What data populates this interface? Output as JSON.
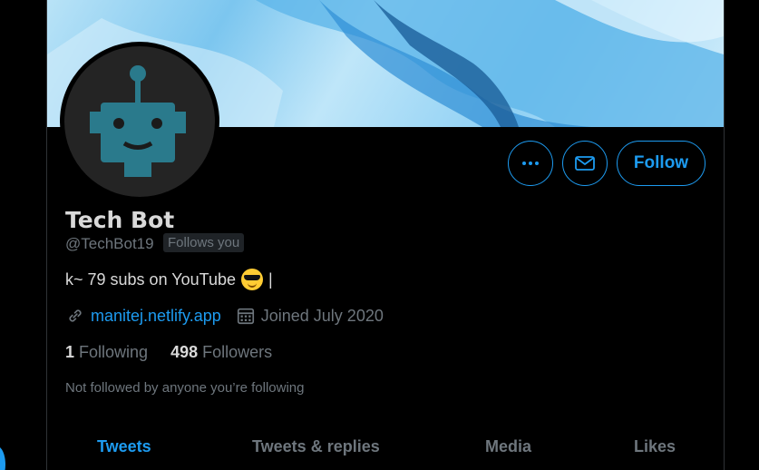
{
  "profile": {
    "name": "Tech Bot",
    "handle": "@TechBot19",
    "follows_you": "Follows you",
    "bio_text": "k~ 79 subs on YouTube",
    "bio_suffix": "|",
    "website": "manitej.netlify.app",
    "joined": "Joined July 2020",
    "following_count": "1",
    "following_label": "Following",
    "followers_count": "498",
    "followers_label": "Followers",
    "not_followed": "Not followed by anyone you’re following"
  },
  "actions": {
    "more_icon": "more-icon",
    "mail_icon": "mail-icon",
    "follow_label": "Follow"
  },
  "tabs": [
    {
      "label": "Tweets",
      "active": true
    },
    {
      "label": "Tweets & replies",
      "active": false
    },
    {
      "label": "Media",
      "active": false
    },
    {
      "label": "Likes",
      "active": false
    }
  ],
  "colors": {
    "accent": "#1d9bf0",
    "muted": "#6e767d",
    "background": "#000000"
  }
}
